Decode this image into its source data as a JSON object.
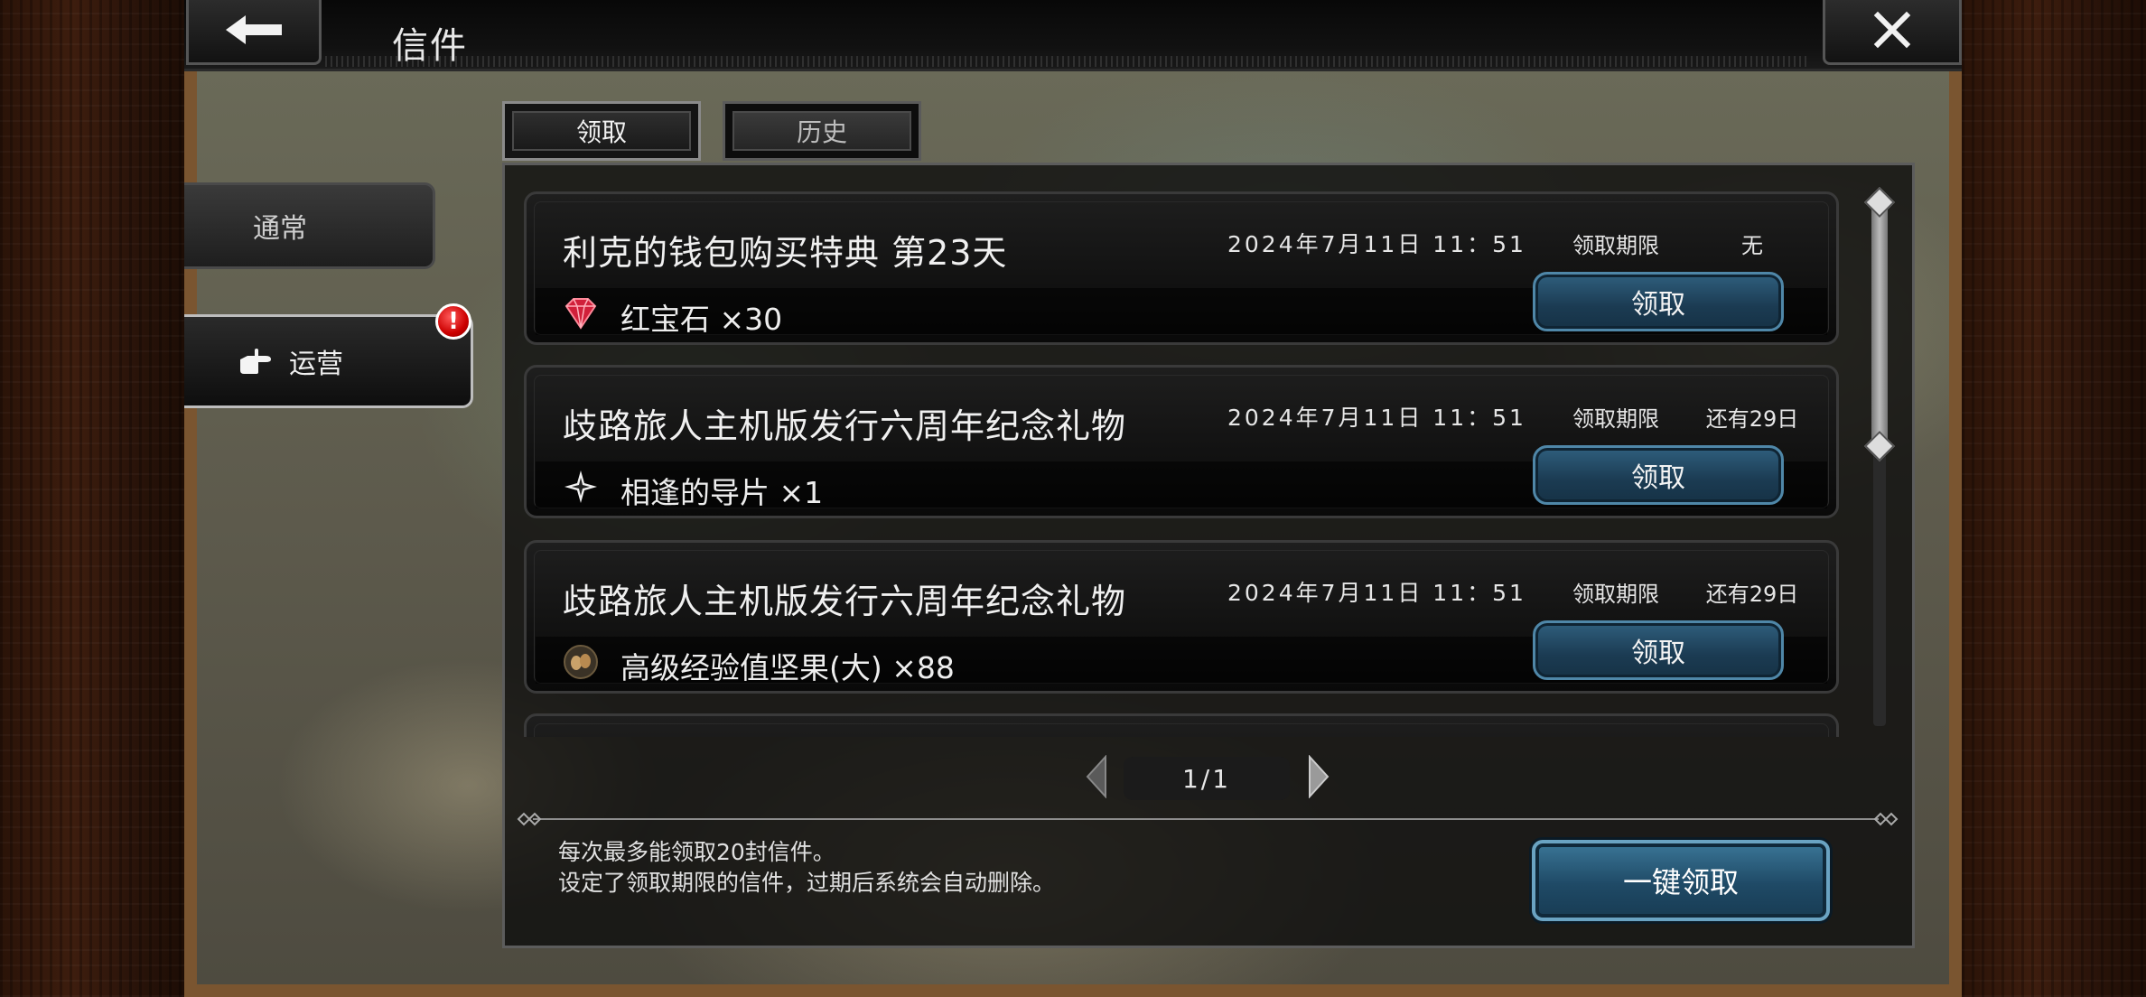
{
  "header": {
    "title": "信件",
    "back_icon": "arrow-left-icon",
    "close_icon": "close-icon"
  },
  "categories": [
    {
      "label": "通常",
      "selected": false
    },
    {
      "label": "运营",
      "selected": true,
      "icon": "pointing-hand-icon",
      "alert": "!"
    }
  ],
  "tabs": [
    {
      "label": "领取",
      "selected": true
    },
    {
      "label": "历史",
      "selected": false
    }
  ],
  "mails": [
    {
      "title": "利克的钱包购买特典 第23天",
      "date": "2024年7月11日 11：51",
      "limit_label": "领取期限",
      "limit_value": "无",
      "reward_icon": "ruby-icon",
      "reward": "红宝石 ×30",
      "button": "领取"
    },
    {
      "title": "歧路旅人主机版发行六周年纪念礼物",
      "date": "2024年7月11日 11：51",
      "limit_label": "领取期限",
      "limit_value": "还有29日",
      "reward_icon": "guiding-shard-icon",
      "reward": "相逢的导片 ×1",
      "button": "领取"
    },
    {
      "title": "歧路旅人主机版发行六周年纪念礼物",
      "date": "2024年7月11日 11：51",
      "limit_label": "领取期限",
      "limit_value": "还有29日",
      "reward_icon": "exp-nut-icon",
      "reward": "高级经验值坚果(大) ×88",
      "button": "领取"
    }
  ],
  "pagination": {
    "label": "1/1"
  },
  "notices": [
    "每次最多能领取20封信件。",
    "设定了领取期限的信件，过期后系统会自动删除。"
  ],
  "claim_all_label": "一键领取",
  "colors": {
    "button_blue": "#1f4a66",
    "alert_red": "#cc0000",
    "ruby_red": "#d0203a"
  }
}
